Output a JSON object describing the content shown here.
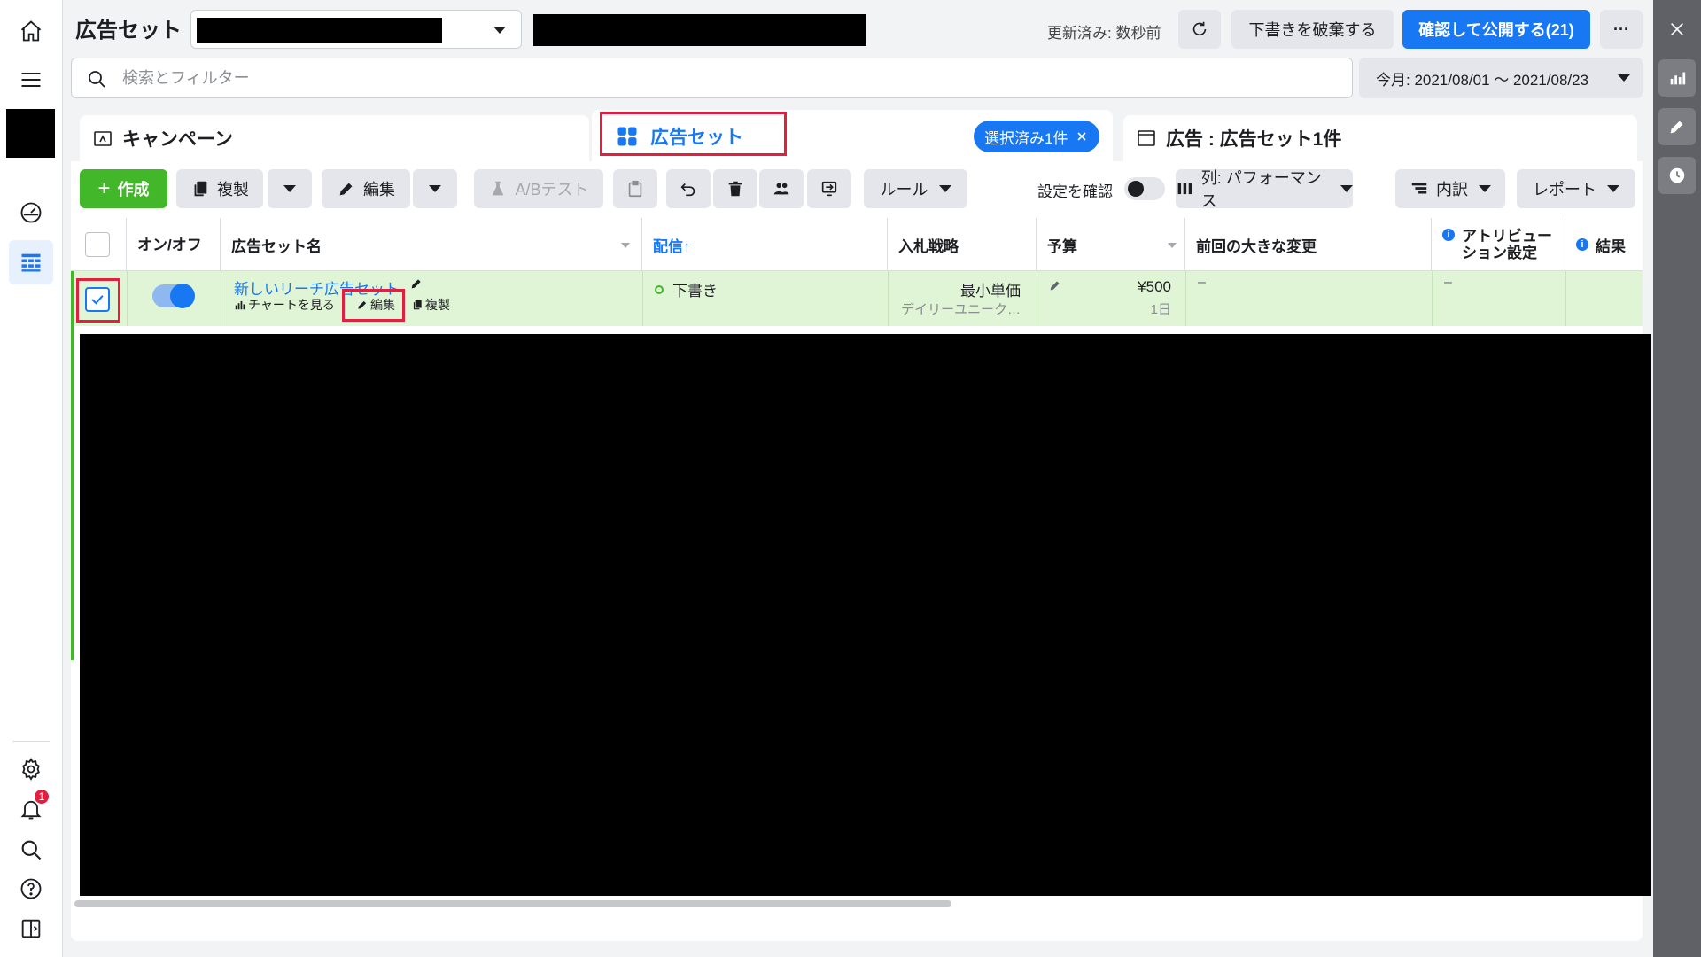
{
  "header": {
    "title": "広告セット",
    "updated": "更新済み: 数秒前",
    "discard_label": "下書きを破棄する",
    "publish_label": "確認して公開する(21)",
    "more_label": "···"
  },
  "search": {
    "placeholder": "検索とフィルター",
    "date_range": "今月: 2021/08/01 ～ 2021/08/23"
  },
  "tabs": {
    "campaign": "キャンペーン",
    "adset": "広告セット",
    "selected_pill": "選択済み1件",
    "ads": "広告 : 広告セット1件"
  },
  "toolbar": {
    "create": "作成",
    "duplicate": "複製",
    "edit": "編集",
    "abtest": "A/Bテスト",
    "rules": "ルール",
    "review_settings": "設定を確認",
    "columns": "列: パフォーマンス",
    "breakdown": "内訳",
    "report": "レポート"
  },
  "table": {
    "headers": {
      "onoff": "オン/オフ",
      "name": "広告セット名",
      "delivery": "配信↑",
      "bid": "入札戦略",
      "budget": "予算",
      "last_change": "前回の大きな変更",
      "attribution": "アトリビューション設定",
      "results": "結果"
    },
    "row": {
      "name": "新しいリーチ広告セット",
      "view_chart": "チャートを見る",
      "edit": "編集",
      "duplicate": "複製",
      "delivery": "下書き",
      "bid_main": "最小単価",
      "bid_sub": "デイリーユニーク…",
      "budget_amount": "¥500",
      "budget_period": "1日",
      "last_change": "–",
      "attribution": "–"
    }
  },
  "nav": {
    "notification_count": "1"
  },
  "colors": {
    "accent": "#1877f2",
    "create_green": "#42b72a",
    "highlight_red": "#e41e3f",
    "row_selected": "#dff5d6"
  }
}
